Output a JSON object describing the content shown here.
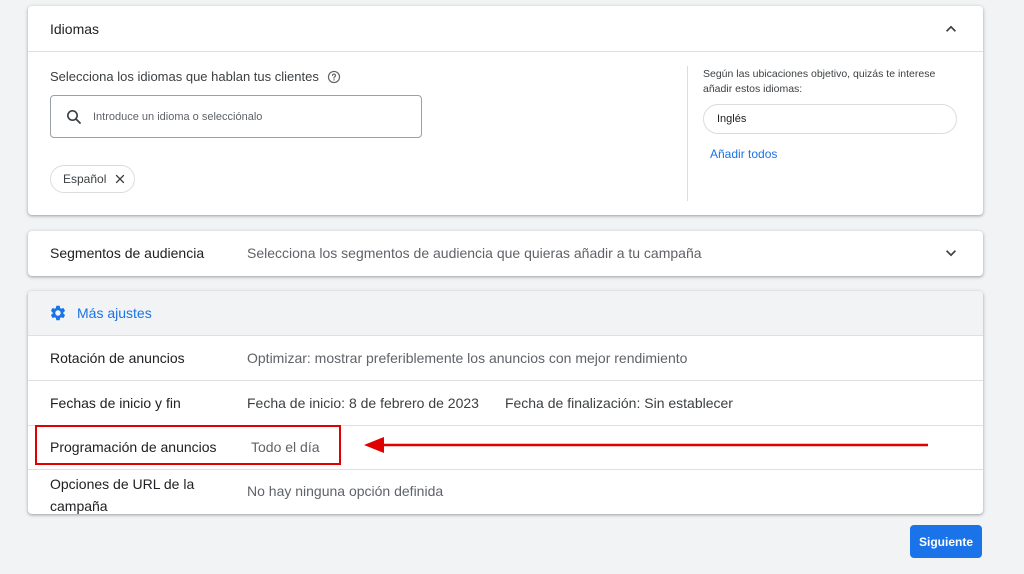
{
  "idiomas": {
    "title": "Idiomas",
    "prompt": "Selecciona los idiomas que hablan tus clientes",
    "search_placeholder": "Introduce un idioma o selecciónalo",
    "selected": [
      "Español"
    ],
    "suggestion_text": "Según las ubicaciones objetivo, quizás te interese añadir estos idiomas:",
    "suggestions": [
      "Inglés"
    ],
    "add_all_label": "Añadir todos"
  },
  "segmentos": {
    "label": "Segmentos de audiencia",
    "value": "Selecciona los segmentos de audiencia que quieras añadir a tu campaña"
  },
  "mas_ajustes": {
    "label": "Más ajustes",
    "rows": [
      {
        "label": "Rotación de anuncios",
        "value": "Optimizar: mostrar preferiblemente los anuncios con mejor rendimiento"
      },
      {
        "label": "Fechas de inicio y fin",
        "value": "Fecha de inicio: 8 de febrero de 2023",
        "value2": "Fecha de finalización: Sin establecer"
      },
      {
        "label": "Programación de anuncios",
        "value": "Todo el día"
      },
      {
        "label": "Opciones de URL de la campaña",
        "value": "No hay ninguna opción definida"
      }
    ]
  },
  "next_label": "Siguiente",
  "colors": {
    "accent": "#1a73e8",
    "annotation": "#e00000"
  },
  "icons": [
    "chevron-up-icon",
    "help-icon",
    "search-icon",
    "close-icon",
    "chevron-down-icon",
    "gear-icon"
  ]
}
